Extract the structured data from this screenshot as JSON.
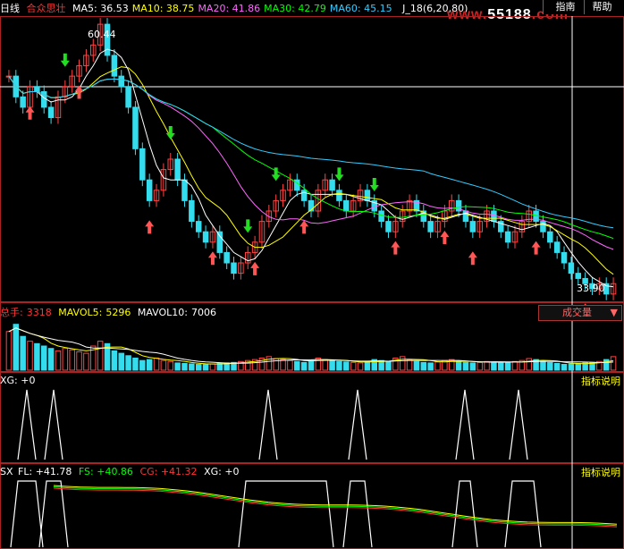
{
  "header": {
    "period": "日线",
    "stock_name": "合众思壮",
    "ma_items": [
      {
        "label": "MA5:",
        "value": "36.53",
        "color": "#ffffff"
      },
      {
        "label": "MA10:",
        "value": "38.75",
        "color": "#ffff00"
      },
      {
        "label": "MA20:",
        "value": "41.86",
        "color": "#ff66ff"
      },
      {
        "label": "MA30:",
        "value": "42.79",
        "color": "#00ff00"
      },
      {
        "label": "MA60:",
        "value": "45.15",
        "color": "#33ccff"
      }
    ],
    "indicator": "J_18(6,20,80)",
    "watermark": "www.55188.com"
  },
  "toolbar": {
    "guide": "指南",
    "help": "帮助"
  },
  "price_chart": {
    "high_label": "60.44",
    "low_label": "33.90"
  },
  "volume_panel": {
    "total_label": "总手:",
    "total_value": "3318",
    "mavol5_label": "MAVOL5:",
    "mavol5_value": "5296",
    "mavol10_label": "MAVOL10:",
    "mavol10_value": "7006",
    "dropdown_label": "成交量"
  },
  "xg_panel": {
    "label": "XG: +0",
    "help": "指标说明"
  },
  "sx_panel": {
    "name": "SX",
    "fl": "FL: +41.78",
    "fs": "FS: +40.86",
    "cg": "CG: +41.32",
    "xg": "XG: +0",
    "help": "指标说明"
  },
  "chart_data": {
    "type": "candlestick",
    "y_axis_price": [
      33.9,
      60.44
    ],
    "closes": [
      55,
      53,
      52,
      54,
      53.5,
      52,
      51,
      53,
      54,
      55,
      56,
      57,
      58,
      60,
      57,
      55,
      54,
      52,
      48,
      45,
      43,
      44,
      46,
      47,
      45,
      43,
      41,
      40,
      39,
      40,
      38,
      37,
      36,
      37,
      38,
      39,
      41,
      42,
      43,
      44,
      45,
      44,
      43,
      42,
      44,
      45,
      44,
      43,
      42,
      43,
      44,
      43,
      42,
      41,
      40,
      41,
      42,
      43,
      42,
      41,
      40,
      41,
      42,
      43,
      42,
      41,
      40,
      41,
      42,
      41,
      40,
      39,
      40,
      41,
      42,
      41,
      40,
      39,
      38,
      37,
      36,
      35.5,
      35,
      34.5,
      35,
      34,
      35
    ],
    "volume": [
      80,
      95,
      70,
      60,
      55,
      50,
      45,
      40,
      45,
      42,
      38,
      35,
      50,
      60,
      55,
      40,
      35,
      30,
      25,
      20,
      22,
      25,
      20,
      18,
      15,
      14,
      13,
      12,
      12,
      13,
      14,
      15,
      16,
      18,
      20,
      22,
      25,
      28,
      24,
      22,
      20,
      18,
      16,
      20,
      25,
      22,
      20,
      18,
      17,
      16,
      15,
      18,
      22,
      20,
      18,
      25,
      28,
      22,
      18,
      16,
      15,
      17,
      20,
      22,
      18,
      16,
      15,
      16,
      18,
      17,
      16,
      15,
      18,
      20,
      24,
      22,
      18,
      16,
      14,
      12,
      13,
      14,
      15,
      16,
      18,
      22,
      28
    ],
    "xg_signals": [
      7,
      13,
      74,
      96,
      129,
      145
    ],
    "signal_up": [
      9,
      36,
      53,
      56,
      95,
      105,
      125,
      139,
      160,
      168
    ],
    "signal_down": [
      21,
      65,
      78,
      118,
      131,
      133
    ]
  }
}
